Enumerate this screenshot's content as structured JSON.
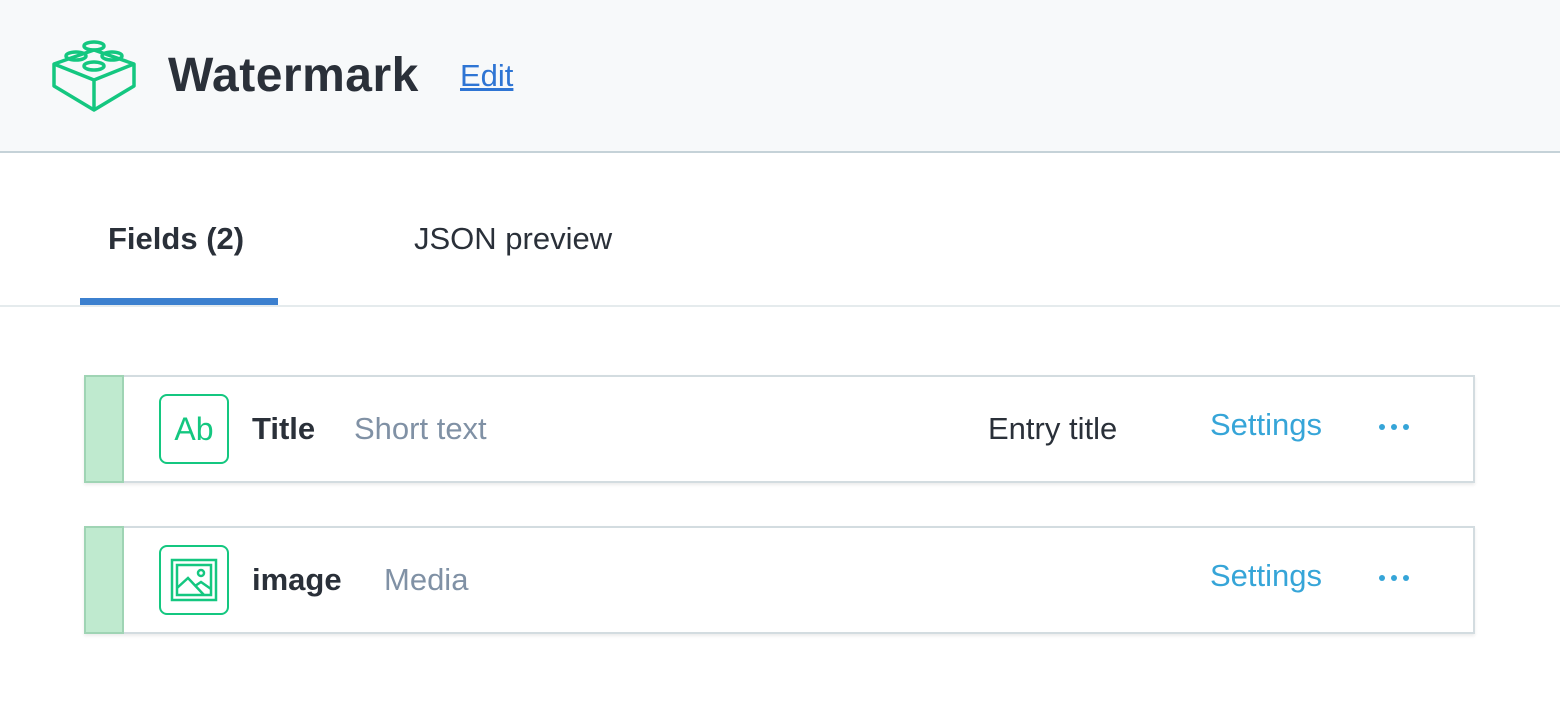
{
  "header": {
    "icon": "lego-block-icon",
    "title": "Watermark",
    "edit_label": "Edit"
  },
  "tabs": [
    {
      "label": "Fields (2)",
      "active": true
    },
    {
      "label": "JSON preview",
      "active": false
    }
  ],
  "fields": [
    {
      "icon": "text-ab-icon",
      "icon_text": "Ab",
      "name": "Title",
      "type": "Short text",
      "badge": "Entry title",
      "settings_label": "Settings",
      "more": "more-icon"
    },
    {
      "icon": "image-icon",
      "name": "image",
      "type": "Media",
      "settings_label": "Settings",
      "more": "more-icon"
    }
  ],
  "colors": {
    "accent": "#3c80cf",
    "icon_green": "#14c780",
    "handle_green": "#bfeacf",
    "link_blue": "#36a5d8"
  }
}
